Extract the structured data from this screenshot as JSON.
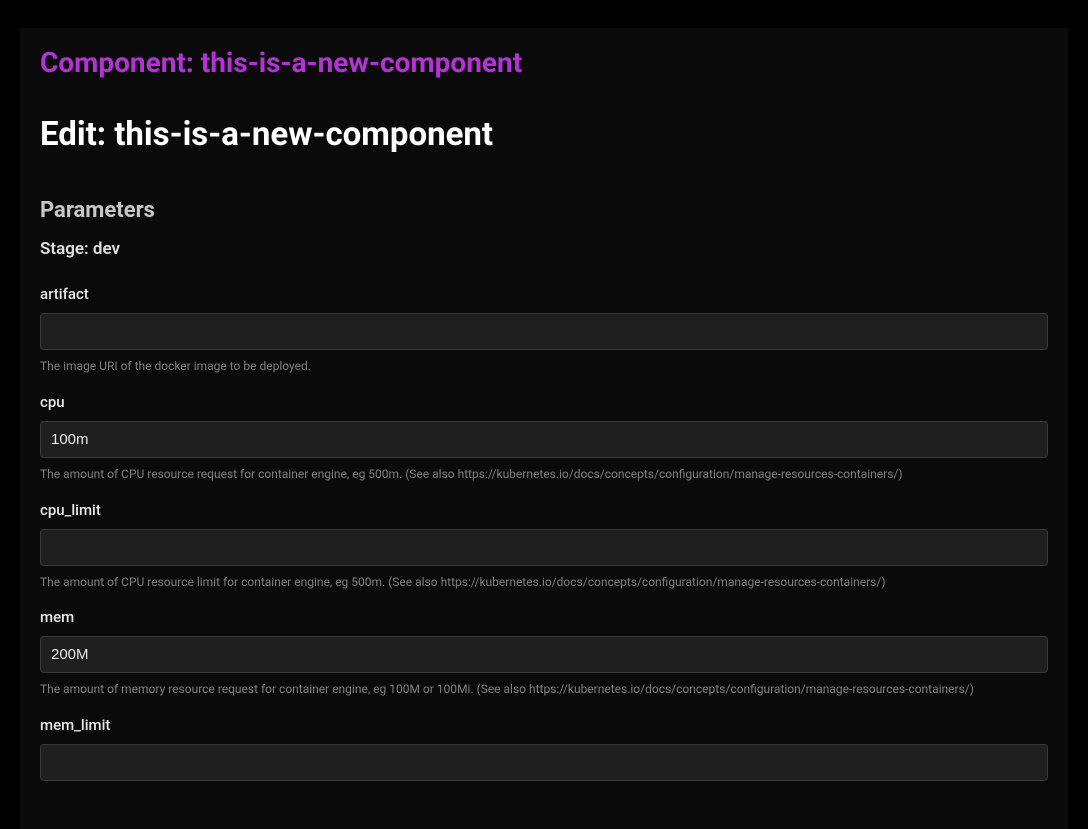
{
  "breadcrumb": "Component: this-is-a-new-component",
  "page_title": "Edit: this-is-a-new-component",
  "section_title": "Parameters",
  "stage_label": "Stage: dev",
  "fields": {
    "artifact": {
      "label": "artifact",
      "value": "",
      "help": "The image URI of the docker image to be deployed."
    },
    "cpu": {
      "label": "cpu",
      "value": "100m",
      "help": "The amount of CPU resource request for container engine, eg 500m. (See also https://kubernetes.io/docs/concepts/configuration/manage-resources-containers/)"
    },
    "cpu_limit": {
      "label": "cpu_limit",
      "value": "",
      "help": "The amount of CPU resource limit for container engine, eg 500m. (See also https://kubernetes.io/docs/concepts/configuration/manage-resources-containers/)"
    },
    "mem": {
      "label": "mem",
      "value": "200M",
      "help": "The amount of memory resource request for container engine, eg 100M or 100Mi. (See also https://kubernetes.io/docs/concepts/configuration/manage-resources-containers/)"
    },
    "mem_limit": {
      "label": "mem_limit",
      "value": "",
      "help": ""
    }
  }
}
